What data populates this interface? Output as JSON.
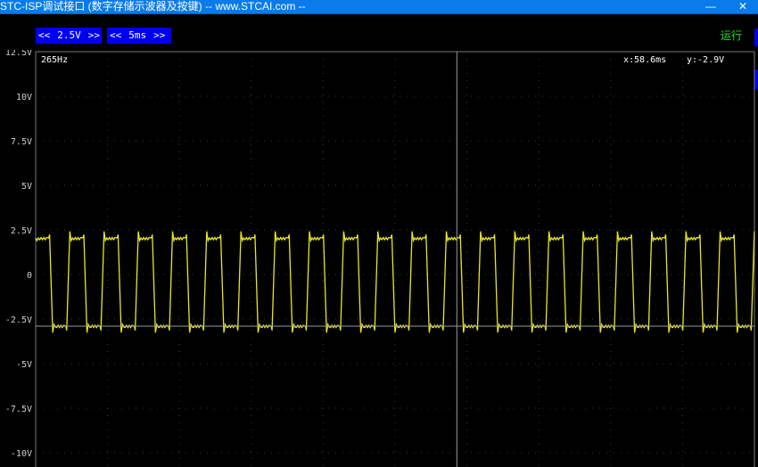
{
  "window": {
    "title": "STC-ISP调试接口 (数字存储示波器及按键) -- www.STCAI.com --",
    "close_glyph": "✕"
  },
  "toolbar": {
    "volt_div": {
      "left": "<<",
      "value": "2.5V",
      "right": ">>"
    },
    "time_div": {
      "left": "<<",
      "value": "5ms",
      "right": ">>"
    },
    "run_state": "运行"
  },
  "scope": {
    "frequency": "265Hz",
    "cursor_x": "x:58.6ms",
    "cursor_y": "y:-2.9V",
    "trace_color": "#e6e62a",
    "grid_color": "#3a3a3a",
    "cursor_color": "#9a9a9a",
    "y_axis": {
      "unit": "V",
      "range": [
        -10,
        12.5
      ],
      "ticks": [
        "12.5V",
        "10V",
        "7.5V",
        "5V",
        "2.5V",
        "0",
        "-2.5V",
        "-5V",
        "-7.5V",
        "-10V"
      ],
      "tick_values": [
        12.5,
        10,
        7.5,
        5,
        2.5,
        0,
        -2.5,
        -5,
        -7.5,
        -10
      ]
    },
    "x_axis": {
      "range_ms": [
        0,
        100
      ]
    },
    "cursor_x_ms": 58.6,
    "cursor_y_v": -2.9,
    "signal": {
      "type": "square",
      "high_v": 2.0,
      "low_v": -2.9,
      "overshoot_v": 0.6,
      "cycles_shown": 21,
      "duty": 0.5
    }
  }
}
